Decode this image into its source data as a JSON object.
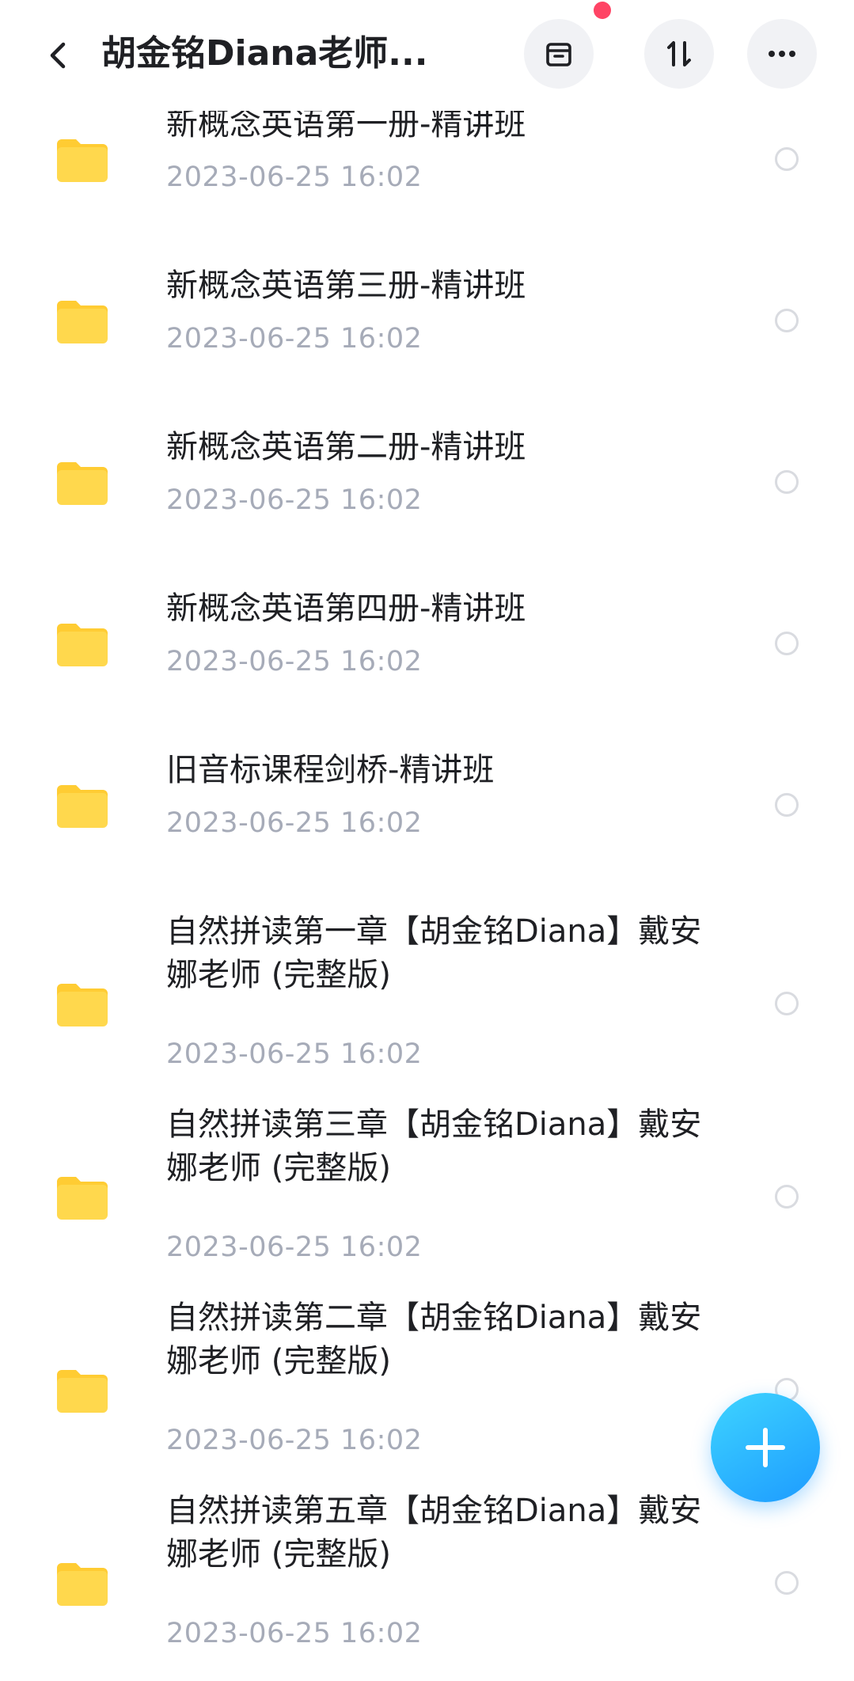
{
  "header": {
    "title": "胡金铭Diana老师...",
    "back_icon": "back-chevron-icon",
    "buttons": [
      {
        "icon": "archive-box-icon"
      },
      {
        "icon": "sort-arrows-icon"
      },
      {
        "icon": "more-dots-icon"
      }
    ],
    "notification_dot_color": "#ff4465"
  },
  "folders": [
    {
      "name_lines": [
        "新概念英语第一册-精讲班"
      ],
      "date": "2023-06-25  16:02"
    },
    {
      "name_lines": [
        "新概念英语第三册-精讲班"
      ],
      "date": "2023-06-25  16:02"
    },
    {
      "name_lines": [
        "新概念英语第二册-精讲班"
      ],
      "date": "2023-06-25  16:02"
    },
    {
      "name_lines": [
        "新概念英语第四册-精讲班"
      ],
      "date": "2023-06-25  16:02"
    },
    {
      "name_lines": [
        "旧音标课程剑桥-精讲班"
      ],
      "date": "2023-06-25  16:02"
    },
    {
      "name_lines": [
        "自然拼读第一章【胡金铭Diana】戴安",
        "娜老师 (完整版)"
      ],
      "date": "2023-06-25  16:02"
    },
    {
      "name_lines": [
        "自然拼读第三章【胡金铭Diana】戴安",
        "娜老师 (完整版)"
      ],
      "date": "2023-06-25  16:02"
    },
    {
      "name_lines": [
        "自然拼读第二章【胡金铭Diana】戴安",
        "娜老师 (完整版)"
      ],
      "date": "2023-06-25  16:02"
    },
    {
      "name_lines": [
        "自然拼读第五章【胡金铭Diana】戴安",
        "娜老师 (完整版)"
      ],
      "date": "2023-06-25  16:02"
    }
  ],
  "fab": {
    "icon": "plus-icon"
  },
  "colors": {
    "folder": "#ffd84d",
    "folder_tab": "#ffcc33",
    "date_text": "#a6abb8",
    "fab_gradient_start": "#3ed4ff",
    "fab_gradient_end": "#1d9bff"
  }
}
